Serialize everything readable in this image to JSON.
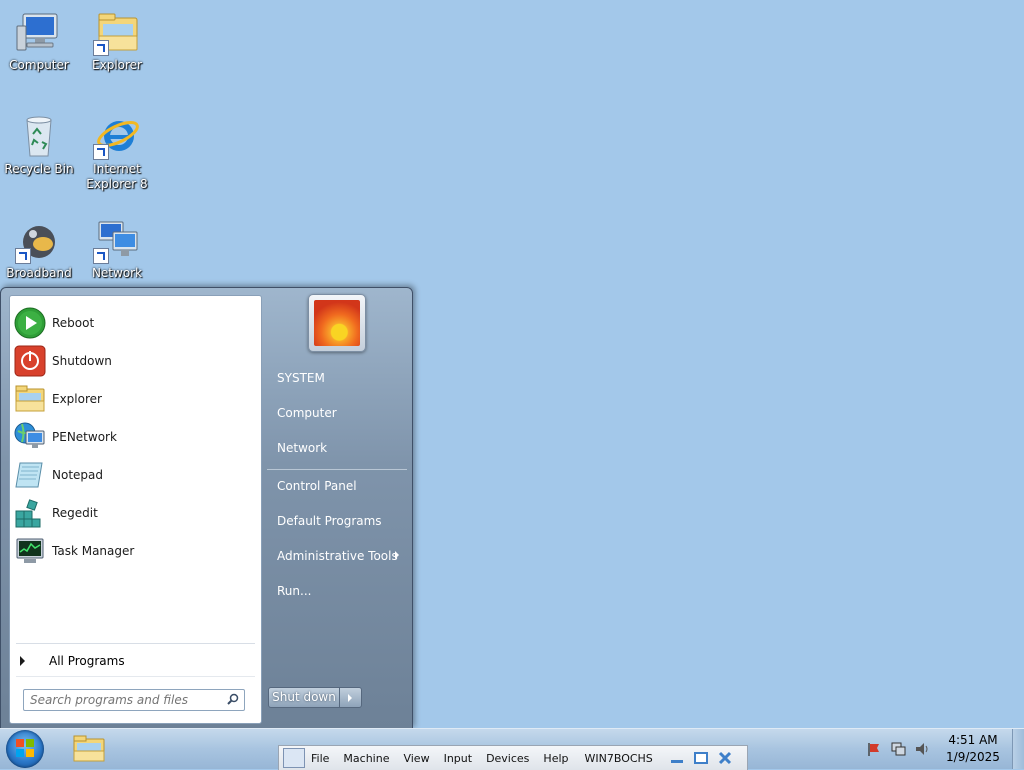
{
  "desktop": {
    "icons": [
      {
        "label": "Computer",
        "icon": "computer-icon"
      },
      {
        "label": "Explorer",
        "icon": "folder-explorer-icon"
      },
      {
        "label": "Recycle Bin",
        "icon": "recycle-bin-icon"
      },
      {
        "label": "Internet Explorer 8",
        "icon": "internet-explorer-icon"
      },
      {
        "label": "Broadband",
        "icon": "broadband-icon"
      },
      {
        "label": "Network",
        "icon": "network-icon"
      }
    ]
  },
  "start_menu": {
    "programs": [
      {
        "label": "Reboot",
        "icon": "reboot-icon"
      },
      {
        "label": "Shutdown",
        "icon": "shutdown-icon"
      },
      {
        "label": "Explorer",
        "icon": "explorer-icon"
      },
      {
        "label": "PENetwork",
        "icon": "penetwork-icon"
      },
      {
        "label": "Notepad",
        "icon": "notepad-icon"
      },
      {
        "label": "Regedit",
        "icon": "regedit-icon"
      },
      {
        "label": "Task Manager",
        "icon": "task-manager-icon"
      }
    ],
    "all_programs": "All Programs",
    "search_placeholder": "Search programs and files",
    "right_items": [
      {
        "label": "SYSTEM"
      },
      {
        "label": "Computer"
      },
      {
        "label": "Network"
      },
      {
        "label": "Control Panel"
      },
      {
        "label": "Default Programs"
      },
      {
        "label": "Administrative Tools",
        "has_submenu": true
      },
      {
        "label": "Run..."
      }
    ],
    "shutdown_label": "Shut down"
  },
  "taskbar": {
    "vbox_menus": [
      "File",
      "Machine",
      "View",
      "Input",
      "Devices",
      "Help"
    ],
    "vbox_title": "WIN7BOCHS",
    "clock_time": "4:51 AM",
    "clock_date": "1/9/2025"
  },
  "colors": {
    "desktop_bg": "#a3c8ea",
    "start_menu_right": "#6d8197",
    "taskbar": "#a8c4e0"
  }
}
